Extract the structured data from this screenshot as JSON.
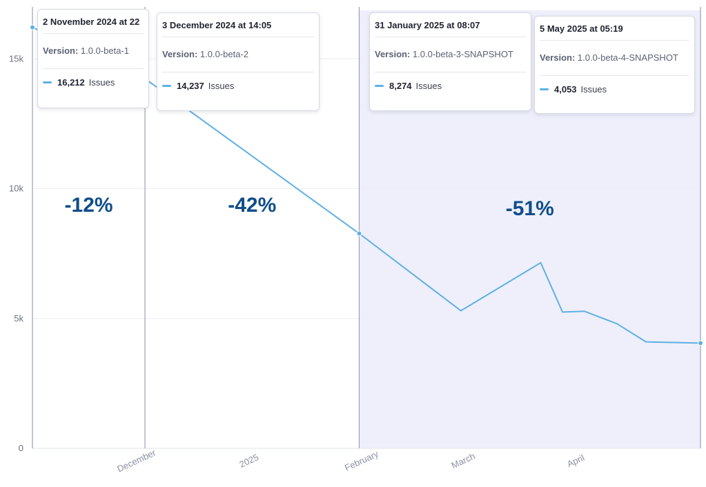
{
  "chart_data": {
    "type": "line",
    "x_axis": {
      "type": "datetime",
      "range": [
        "2024-11-02",
        "2025-05-05"
      ],
      "tick_labels": [
        "December",
        "2025",
        "February",
        "March",
        "April"
      ]
    },
    "y_axis": {
      "range": [
        0,
        17000
      ],
      "tick_labels": [
        "0",
        "5k",
        "10k",
        "15k"
      ],
      "grid": true
    },
    "series": [
      {
        "color": "#5fb0e3",
        "points": [
          {
            "x": "2024-11-02",
            "y": 16212
          },
          {
            "x": "2024-12-03",
            "y": 14237
          },
          {
            "x": "2025-01-31",
            "y": 8274
          },
          {
            "x": "2025-02-28",
            "y": 5300
          },
          {
            "x": "2025-03-22",
            "y": 7150
          },
          {
            "x": "2025-03-28",
            "y": 5250
          },
          {
            "x": "2025-04-03",
            "y": 5280
          },
          {
            "x": "2025-04-12",
            "y": 4800
          },
          {
            "x": "2025-04-20",
            "y": 4100
          },
          {
            "x": "2025-05-05",
            "y": 4053
          }
        ]
      }
    ],
    "releases": [
      {
        "date": "2024-11-02",
        "date_label": "2 November 2024 at 22",
        "version": "1.0.0-beta-1",
        "issues": "16,212"
      },
      {
        "date": "2024-12-03",
        "date_label": "3 December 2024 at 14:05",
        "version": "1.0.0-beta-2",
        "issues": "14,237"
      },
      {
        "date": "2025-01-31",
        "date_label": "31 January 2025 at 08:07",
        "version": "1.0.0-beta-3-SNAPSHOT",
        "issues": "8,274"
      },
      {
        "date": "2025-05-05",
        "date_label": "5 May 2025 at 05:19",
        "version": "1.0.0-beta-4-SNAPSHOT",
        "issues": "4,053"
      }
    ],
    "change_labels": [
      {
        "from": "2024-11-02",
        "to": "2024-12-03",
        "text": "-12%"
      },
      {
        "from": "2024-12-03",
        "to": "2025-01-31",
        "text": "-42%"
      },
      {
        "from": "2025-01-31",
        "to": "2025-05-05",
        "text": "-51%",
        "highlighted": true
      }
    ],
    "highlight_color": "#eeeffa",
    "label_color": "#0f4d8a"
  },
  "tooltip": {
    "version_label": "Version:",
    "issues_label": "Issues"
  }
}
